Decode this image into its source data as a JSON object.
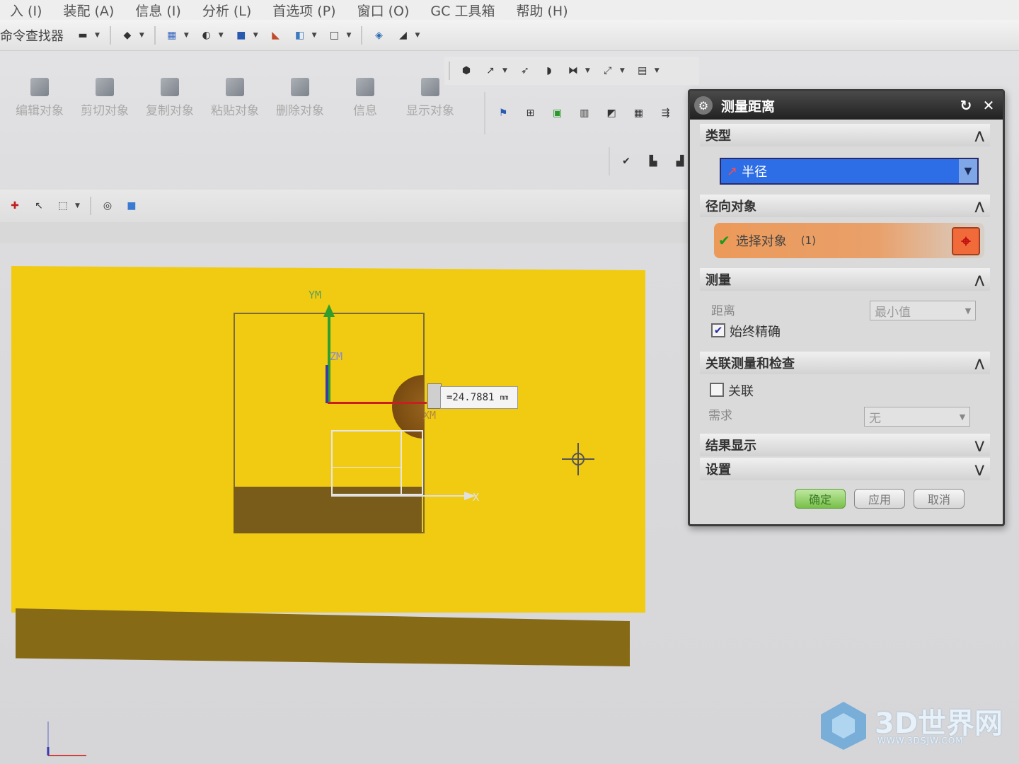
{
  "menu": {
    "items": [
      "入 (I)",
      "装配 (A)",
      "信息 (I)",
      "分析 (L)",
      "首选项 (P)",
      "窗口 (O)",
      "GC 工具箱",
      "帮助 (H)"
    ]
  },
  "toolbar": {
    "command_finder": "命令查找器"
  },
  "ribbon": {
    "buttons": [
      "编辑对象",
      "剪切对象",
      "复制对象",
      "粘贴对象",
      "删除对象",
      "信息",
      "显示对象"
    ]
  },
  "viewport": {
    "axis_ym": "YM",
    "axis_zm": "ZM",
    "axis_xm": "XM",
    "axis_x": "X",
    "measure_value": "=24.7881",
    "measure_unit": "mm"
  },
  "dialog": {
    "title": "测量距离",
    "sections": {
      "type": {
        "header": "类型",
        "selected": "半径"
      },
      "radial_object": {
        "header": "径向对象",
        "select_label": "选择对象",
        "select_count": "(1)"
      },
      "measure": {
        "header": "测量",
        "distance_label": "距离",
        "distance_value": "最小值",
        "always_accurate_label": "始终精确",
        "always_accurate_checked": true
      },
      "associate": {
        "header": "关联测量和检查",
        "associate_label": "关联",
        "associate_checked": false,
        "requirement_label": "需求",
        "requirement_value": "无"
      },
      "result_display": {
        "header": "结果显示"
      },
      "settings": {
        "header": "设置"
      }
    },
    "buttons": {
      "ok": "确定",
      "apply": "应用",
      "cancel": "取消"
    }
  },
  "watermark": {
    "text": "3D世界网",
    "url": "WWW.3DSJW.COM"
  },
  "colors": {
    "plane_yellow": "#f1cb12",
    "plane_brown": "#866a16",
    "select_orange": "#ec9a5a",
    "type_blue": "#2d6ee6",
    "ok_green": "#78c048"
  }
}
